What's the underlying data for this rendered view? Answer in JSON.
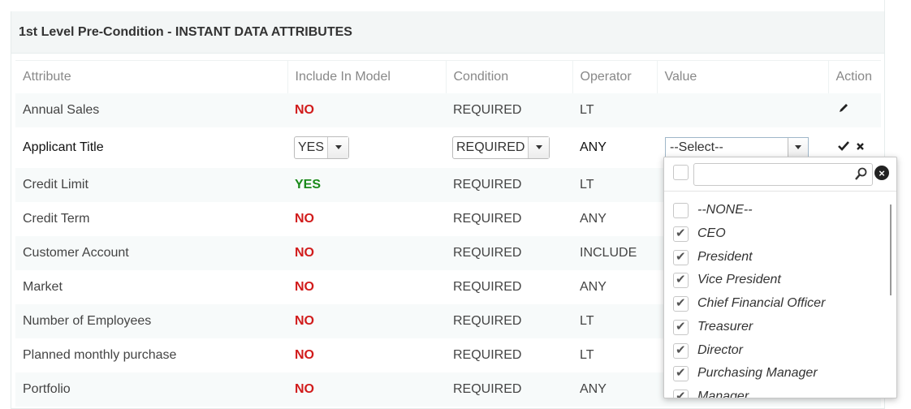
{
  "panel": {
    "title": "1st Level Pre-Condition - INSTANT DATA ATTRIBUTES"
  },
  "table": {
    "headers": [
      "Attribute",
      "Include In Model",
      "Condition",
      "Operator",
      "Value",
      "Action"
    ],
    "rows": [
      {
        "attribute": "Annual Sales",
        "include": "NO",
        "condition": "REQUIRED",
        "operator": "LT",
        "value": ""
      },
      {
        "attribute": "Applicant Title",
        "include": "YES",
        "condition": "REQUIRED",
        "operator": "ANY",
        "value": "--Select--"
      },
      {
        "attribute": "Credit Limit",
        "include": "YES",
        "condition": "REQUIRED",
        "operator": "LT",
        "value": ""
      },
      {
        "attribute": "Credit Term",
        "include": "NO",
        "condition": "REQUIRED",
        "operator": "ANY",
        "value": ""
      },
      {
        "attribute": "Customer Account",
        "include": "NO",
        "condition": "REQUIRED",
        "operator": "INCLUDE",
        "value": ""
      },
      {
        "attribute": "Market",
        "include": "NO",
        "condition": "REQUIRED",
        "operator": "ANY",
        "value": ""
      },
      {
        "attribute": "Number of Employees",
        "include": "NO",
        "condition": "REQUIRED",
        "operator": "LT",
        "value": ""
      },
      {
        "attribute": "Planned monthly purchase",
        "include": "NO",
        "condition": "REQUIRED",
        "operator": "LT",
        "value": ""
      },
      {
        "attribute": "Portfolio",
        "include": "NO",
        "condition": "REQUIRED",
        "operator": "ANY",
        "value": ""
      }
    ]
  },
  "dropdown": {
    "search_value": "",
    "options": [
      {
        "label": "--NONE--",
        "checked": false
      },
      {
        "label": "CEO",
        "checked": true
      },
      {
        "label": "President",
        "checked": true
      },
      {
        "label": "Vice President",
        "checked": true
      },
      {
        "label": "Chief Financial Officer",
        "checked": true
      },
      {
        "label": "Treasurer",
        "checked": true
      },
      {
        "label": "Director",
        "checked": true
      },
      {
        "label": "Purchasing Manager",
        "checked": true
      },
      {
        "label": "Manager",
        "checked": true
      }
    ]
  },
  "icons": {
    "edit": "pencil-icon",
    "save": "check-icon",
    "cancel": "close-icon",
    "search": "search-icon",
    "clear": "clear-icon"
  },
  "colors": {
    "no": "#d11b1b",
    "yes": "#1a8a1a",
    "header_bg": "#f3f6f6"
  }
}
